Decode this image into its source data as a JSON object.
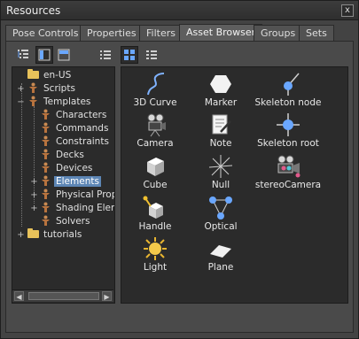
{
  "window": {
    "title": "Resources",
    "close_glyph": "x"
  },
  "tabs": [
    "Pose Controls",
    "Properties",
    "Filters",
    "Asset Browser",
    "Groups",
    "Sets"
  ],
  "active_tab": "Asset Browser",
  "toolbar": [
    "tree-view-icon",
    "split-vertical-icon",
    "split-horizontal-icon",
    "list-view-icon",
    "grid-view-icon",
    "detail-view-icon"
  ],
  "tree": [
    {
      "label": "en-US",
      "icon": "folder-icon"
    },
    {
      "label": "Scripts",
      "icon": "figure-icon",
      "expander": "+"
    },
    {
      "label": "Templates",
      "icon": "figure-icon",
      "expander": "−"
    },
    {
      "label": "Characters",
      "icon": "figure-icon"
    },
    {
      "label": "Commands",
      "icon": "figure-icon"
    },
    {
      "label": "Constraints",
      "icon": "figure-icon"
    },
    {
      "label": "Decks",
      "icon": "figure-icon"
    },
    {
      "label": "Devices",
      "icon": "figure-icon"
    },
    {
      "label": "Elements",
      "icon": "figure-icon",
      "expander": "+",
      "selected": true
    },
    {
      "label": "Physical Proper",
      "icon": "figure-icon",
      "expander": "+"
    },
    {
      "label": "Shading Elemen",
      "icon": "figure-icon",
      "expander": "+"
    },
    {
      "label": "Solvers",
      "icon": "figure-icon"
    },
    {
      "label": "tutorials",
      "icon": "folder-icon",
      "expander": "+"
    }
  ],
  "assets": [
    {
      "label": "3D Curve",
      "icon": "curve-icon"
    },
    {
      "label": "Marker",
      "icon": "marker-icon"
    },
    {
      "label": "Skeleton node",
      "icon": "skeleton-node-icon"
    },
    {
      "label": "Camera",
      "icon": "camera-icon"
    },
    {
      "label": "Note",
      "icon": "note-icon"
    },
    {
      "label": "Skeleton root",
      "icon": "skeleton-root-icon"
    },
    {
      "label": "Cube",
      "icon": "cube-icon"
    },
    {
      "label": "Null",
      "icon": "null-icon"
    },
    {
      "label": "stereoCamera",
      "icon": "stereo-camera-icon"
    },
    {
      "label": "Handle",
      "icon": "handle-icon"
    },
    {
      "label": "Optical",
      "icon": "optical-icon"
    },
    {
      "label": "Light",
      "icon": "light-icon"
    },
    {
      "label": "Plane",
      "icon": "plane-icon"
    }
  ],
  "scrollbar": {
    "left_arrow": "◀",
    "right_arrow": "▶"
  },
  "colors": {
    "selection": "#5d86b5",
    "folder": "#e8c25a",
    "accent_blue": "#6aa7ff"
  }
}
